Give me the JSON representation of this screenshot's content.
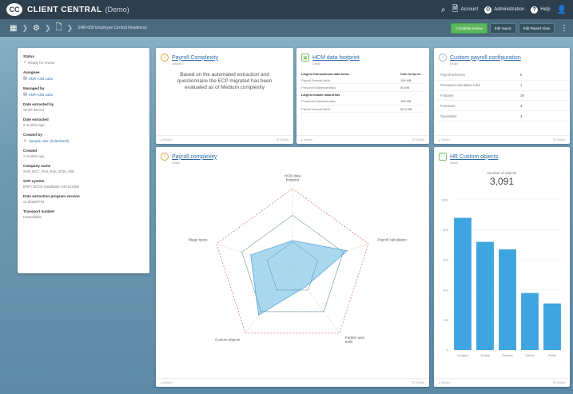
{
  "topbar": {
    "brand": "CLIENT CENTRAL",
    "brand_sub": "(Demo)",
    "items": [
      "Account",
      "Administration",
      "Help"
    ]
  },
  "subbar": {
    "breadcrumb": "SNR-009 Employee Central Readiness",
    "actions": [
      "Complete review",
      "Edit report",
      "Edit Report View"
    ]
  },
  "left_panel": {
    "fields": [
      {
        "label": "Status",
        "value": "Ready for review",
        "icon": "check-icon",
        "link": false
      },
      {
        "label": "Assignee",
        "value": "SNR-ASB Labs",
        "icon": "building-icon",
        "link": true
      },
      {
        "label": "Managed by",
        "value": "SNR-ASB Labs",
        "icon": "building-icon",
        "link": true
      },
      {
        "label": "Date extracted by",
        "value": "SFSF-Demo1",
        "icon": "",
        "link": false
      },
      {
        "label": "Date extracted",
        "value": "2 months ago",
        "icon": "",
        "link": false
      },
      {
        "label": "Created by",
        "value": "Sample user (SolarWorld)",
        "icon": "user-icon",
        "link": true
      },
      {
        "label": "Created",
        "value": "2 months ago",
        "icon": "",
        "link": false
      },
      {
        "label": "Company name",
        "value": "SAB_ECC_Test_Run_2016_008",
        "icon": "",
        "link": false
      },
      {
        "label": "SAP system",
        "value": "ERP / ECC6 Installation SN-123456",
        "icon": "",
        "link": false
      },
      {
        "label": "Data extraction program version",
        "value": "v2.8build-FIN",
        "icon": "",
        "link": false
      },
      {
        "label": "Transport number",
        "value": "Unavailable",
        "icon": "",
        "link": false
      }
    ]
  },
  "cards": {
    "complexity": {
      "title": "Payroll Complexity",
      "sub": "Medium",
      "body": "Based on the automated extraction and questionnaire the ECP migrated has been evaluated as of Medium complexity",
      "foot_left": "▴ Hidden",
      "foot_right": "☰ Details"
    },
    "hcm": {
      "title": "HCM data footprint",
      "sub": "Detail",
      "rows": [
        {
          "k": "Largest transactional data areas",
          "v": "Data footprint",
          "head": true
        },
        {
          "k": "Payroll Several fields",
          "v": "154 MB",
          "head": false
        },
        {
          "k": "Personnel Administration",
          "v": "54 MB",
          "head": false
        },
        {
          "k": "Largest master data areas",
          "v": "",
          "head": true
        },
        {
          "k": "Personnel Administration",
          "v": "128 MB",
          "head": false
        },
        {
          "k": "Payroll Several fields",
          "v": "52.3 MB",
          "head": false
        }
      ],
      "foot_left": "▴ Hidden",
      "foot_right": "☰ Details"
    },
    "config": {
      "title": "Custom payroll configuration",
      "sub": "Detail",
      "rows": [
        {
          "k": "Payroll schemas",
          "v": "8"
        },
        {
          "k": "Personnel calculation rules",
          "v": "1"
        },
        {
          "k": "Features",
          "v": "19"
        },
        {
          "k": "Functions",
          "v": "3"
        },
        {
          "k": "Operations",
          "v": "3"
        }
      ],
      "foot_left": "▴ Hidden",
      "foot_right": "☰ Details"
    },
    "radar": {
      "title": "Payroll complexity",
      "sub": "Detail",
      "foot_left": "▴ Hidden",
      "foot_right": "☰ Details"
    },
    "objects": {
      "title": "HR Custom objects",
      "sub": "Detail",
      "metric_label": "Number of objects",
      "metric_value": "3,091",
      "foot_left": "▴ Hidden",
      "foot_right": "☰ Details"
    }
  },
  "chart_data": [
    {
      "type": "radar",
      "axes": [
        "HCM data footprint",
        "Payroll calculation",
        "Further user exits",
        "Custom objects",
        "Wage types"
      ],
      "series": [
        {
          "values": [
            0.35,
            0.72,
            0.28,
            0.72,
            0.55
          ]
        }
      ],
      "rings": 3
    },
    {
      "type": "bar",
      "categories": [
        "Infotype",
        "Scripts",
        "Reports",
        "Tables",
        "Fields"
      ],
      "values": [
        880,
        720,
        670,
        380,
        310
      ],
      "ylim": [
        0,
        1000
      ],
      "yticks": [
        "1000",
        "800",
        "600",
        "400",
        "200",
        "0"
      ],
      "color": "#3ea5e0"
    }
  ]
}
